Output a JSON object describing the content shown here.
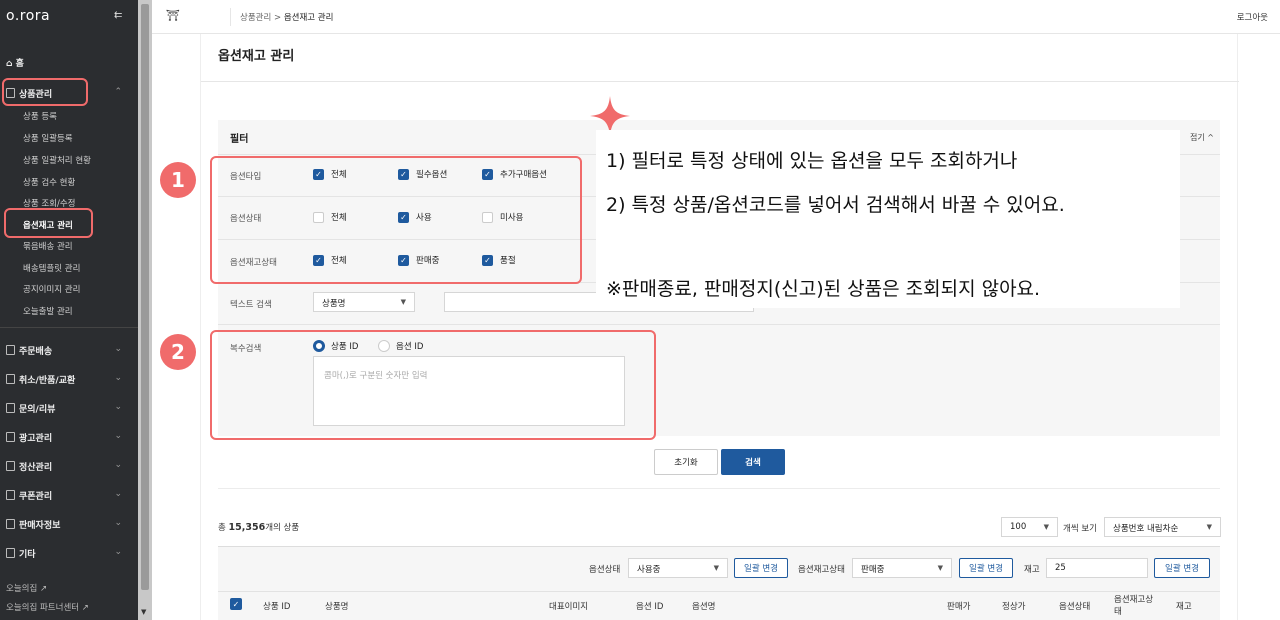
{
  "brand": "o.rora",
  "sidebar": {
    "home": "홈",
    "product_mgmt": "상품관리",
    "sub_items": [
      "상품 등록",
      "상품 일괄등록",
      "상품 일괄처리 현황",
      "상품 검수 현황",
      "상품 조회/수정",
      "옵션재고 관리",
      "묶음배송 관리",
      "배송템플릿 관리",
      "공지이미지 관리",
      "오늘출발 관리"
    ],
    "sections": [
      "주문배송",
      "취소/반품/교환",
      "문의/리뷰",
      "광고관리",
      "정산관리",
      "쿠폰관리",
      "판매자정보",
      "기타"
    ],
    "footer_links": [
      "오늘의집",
      "오늘의집 파트너센터"
    ]
  },
  "topbar": {
    "breadcrumb_parent": "상품관리",
    "breadcrumb_sep": ">",
    "breadcrumb_current": "옵션재고 관리",
    "logout": "로그아웃"
  },
  "page": {
    "title": "옵션재고 관리"
  },
  "filter": {
    "title": "필터",
    "fold": "접기 ^",
    "option_type": {
      "label": "옵션타입",
      "options": [
        {
          "label": "전체",
          "checked": true
        },
        {
          "label": "필수옵션",
          "checked": true
        },
        {
          "label": "추가구매옵션",
          "checked": true
        }
      ]
    },
    "option_status": {
      "label": "옵션상태",
      "options": [
        {
          "label": "전체",
          "checked": false
        },
        {
          "label": "사용",
          "checked": true
        },
        {
          "label": "미사용",
          "checked": false
        }
      ]
    },
    "stock_status": {
      "label": "옵션재고상태",
      "options": [
        {
          "label": "전체",
          "checked": true
        },
        {
          "label": "판매중",
          "checked": true
        },
        {
          "label": "품절",
          "checked": true
        }
      ]
    },
    "text_search": {
      "label": "텍스트 검색",
      "select_value": "상품명",
      "input_value": ""
    },
    "multi_search": {
      "label": "복수검색",
      "radio_selected": "상품 ID",
      "radio_other": "옵션 ID",
      "placeholder": "콤마(,)로 구분된 숫자만 입력"
    },
    "reset_label": "초기화",
    "search_label": "검색"
  },
  "results": {
    "total_prefix": "총",
    "total_count": "15,356",
    "total_suffix": "개의 상품",
    "page_size": "100",
    "page_size_label": "개씩 보기",
    "sort": "상품번호 내림차순",
    "bulk": {
      "option_status_label": "옵션상태",
      "option_status_value": "사용중",
      "apply_label": "일괄 변경",
      "stock_status_label": "옵션재고상태",
      "stock_status_value": "판매중",
      "stock_label": "재고",
      "stock_value": "25"
    },
    "columns": [
      "상품 ID",
      "상품명",
      "대표이미지",
      "옵션 ID",
      "옵션명",
      "판매가",
      "정상가",
      "옵션상태",
      "옵션재고상",
      "태",
      "재고"
    ]
  },
  "overlay": {
    "line1": "1) 필터로 특정 상태에 있는 옵션을 모두 조회하거나",
    "line2": "2) 특정 상품/옵션코드를 넣어서 검색해서 바꿀 수 있어요.",
    "note": "※판매종료, 판매정지(신고)된 상품은 조회되지 않아요.",
    "badge1": "1",
    "badge2": "2"
  },
  "colors": {
    "accent": "#1f5a9e",
    "highlight": "#f06b6b",
    "sidebar_bg": "#2b2d30"
  }
}
